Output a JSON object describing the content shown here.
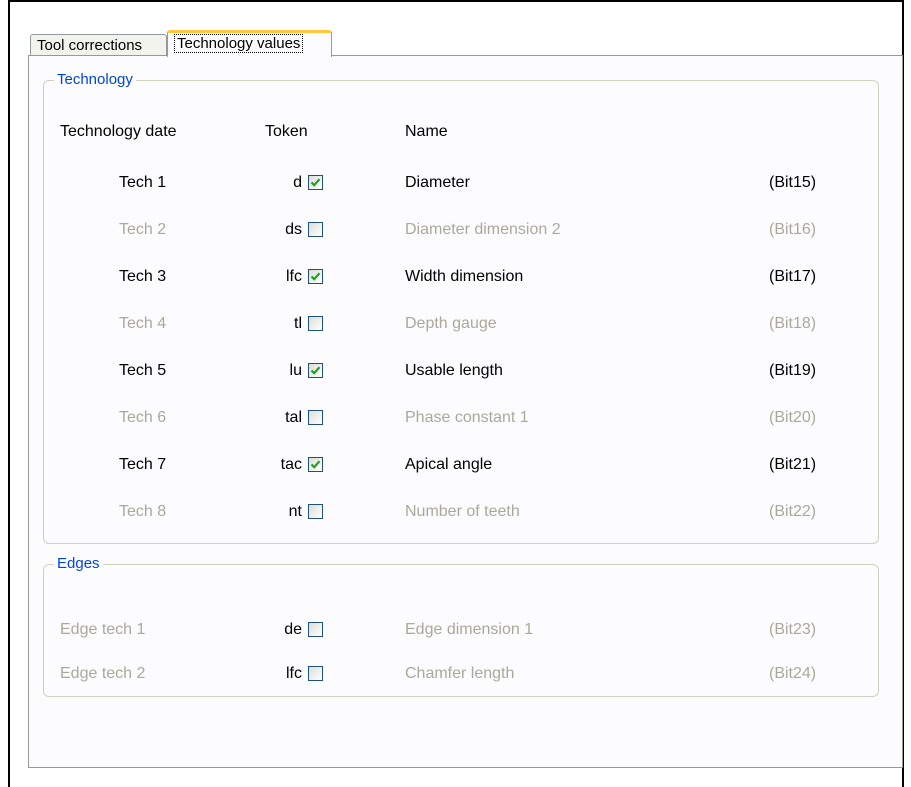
{
  "tabs": [
    {
      "label": "Tool corrections",
      "active": false
    },
    {
      "label": "Technology values",
      "active": true
    }
  ],
  "technology": {
    "legend": "Technology",
    "headers": {
      "date": "Technology date",
      "token": "Token",
      "name": "Name"
    },
    "rows": [
      {
        "date": "Tech 1",
        "token": "d",
        "checked": true,
        "name": "Diameter",
        "bit": "(Bit15)"
      },
      {
        "date": "Tech 2",
        "token": "ds",
        "checked": false,
        "name": "Diameter dimension 2",
        "bit": "(Bit16)"
      },
      {
        "date": "Tech 3",
        "token": "lfc",
        "checked": true,
        "name": "Width dimension",
        "bit": "(Bit17)"
      },
      {
        "date": "Tech 4",
        "token": "tl",
        "checked": false,
        "name": "Depth gauge",
        "bit": "(Bit18)"
      },
      {
        "date": "Tech 5",
        "token": "lu",
        "checked": true,
        "name": "Usable length",
        "bit": "(Bit19)"
      },
      {
        "date": "Tech 6",
        "token": "tal",
        "checked": false,
        "name": "Phase constant 1",
        "bit": "(Bit20)"
      },
      {
        "date": "Tech 7",
        "token": "tac",
        "checked": true,
        "name": "Apical angle",
        "bit": "(Bit21)"
      },
      {
        "date": "Tech 8",
        "token": "nt",
        "checked": false,
        "name": "Number of teeth",
        "bit": "(Bit22)"
      }
    ]
  },
  "edges": {
    "legend": "Edges",
    "rows": [
      {
        "date": "Edge tech 1",
        "token": "de",
        "checked": false,
        "name": "Edge dimension 1",
        "bit": "(Bit23)"
      },
      {
        "date": "Edge tech 2",
        "token": "lfc",
        "checked": false,
        "name": "Chamfer length",
        "bit": "(Bit24)"
      }
    ]
  },
  "colors": {
    "legend": "#0046d5",
    "disabled": "#aca899",
    "check": "#21a121",
    "tab_highlight": "#ffc83c"
  }
}
